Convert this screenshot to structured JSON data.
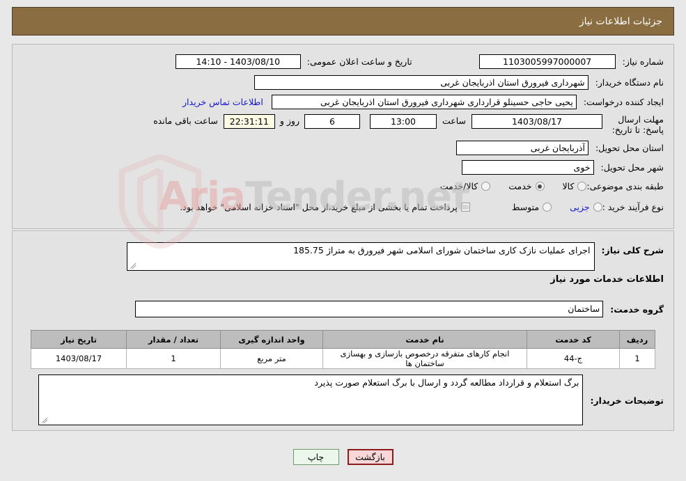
{
  "header": {
    "title": "جزئیات اطلاعات نیاز"
  },
  "form": {
    "need_number_label": "شماره نیاز:",
    "need_number_value": "1103005997000007",
    "announce_label": "تاریخ و ساعت اعلان عمومی:",
    "announce_value": "1403/08/10 - 14:10",
    "buyer_org_label": "نام دستگاه خریدار:",
    "buyer_org_value": "شهرداری فیرورق استان اذربایجان غربی",
    "requester_label": "ایجاد کننده درخواست:",
    "requester_value": "یحیی حاجی حسینلو قرارداری شهرداری فیرورق استان اذربایجان غربی",
    "contact_link": "اطلاعات تماس خریدار",
    "deadline_label": "مهلت ارسال پاسخ: تا تاریخ:",
    "deadline_date": "1403/08/17",
    "time_label": "ساعت",
    "deadline_time": "13:00",
    "days_value": "6",
    "days_label": "روز و",
    "countdown_value": "22:31:11",
    "remaining_label": "ساعت باقی مانده",
    "province_label": "استان محل تحویل:",
    "province_value": "آذربایجان غربی",
    "city_label": "شهر محل تحویل:",
    "city_value": "خوی",
    "category_label": "طبقه بندی موضوعی:",
    "category_options": [
      {
        "label": "کالا",
        "selected": false
      },
      {
        "label": "خدمت",
        "selected": true
      },
      {
        "label": "کالا/خدمت",
        "selected": false
      }
    ],
    "purchase_type_label": "نوع فرآیند خرید :",
    "purchase_options": [
      {
        "label": "جزیی",
        "selected": false
      },
      {
        "label": "متوسط",
        "selected": false
      }
    ],
    "treasury_checkbox_label": "پرداخت تمام یا بخشی از مبلغ خرید،از محل \"اسناد خزانه اسلامی\" خواهد بود.",
    "treasury_checked": false
  },
  "description": {
    "label": "شرح کلی نیاز:",
    "value": "اجرای عملیات نازک کاری ساختمان شورای اسلامی شهر فیرورق به متراژ 185.75"
  },
  "services": {
    "section_title": "اطلاعات خدمات مورد نیاز",
    "group_label": "گروه خدمت:",
    "group_value": "ساختمان",
    "columns": [
      "ردیف",
      "کد خدمت",
      "نام خدمت",
      "واحد اندازه گیری",
      "تعداد / مقدار",
      "تاریخ نیاز"
    ],
    "rows": [
      {
        "index": "1",
        "code": "ج-44",
        "name": "انجام کارهای متفرقه درخصوص بازسازی و بهسازی ساختمان ها",
        "unit": "متر مربع",
        "quantity": "1",
        "need_date": "1403/08/17"
      }
    ]
  },
  "buyer_notes": {
    "label": "توضیحات خریدار:",
    "value": "برگ استعلام و قرارداد مطالعه گردد و ارسال با برگ استعلام صورت پذیرد"
  },
  "footer": {
    "print_label": "چاپ",
    "back_label": "بازگشت"
  },
  "watermark": {
    "text_left": "Aria",
    "text_right": "Tender.net"
  },
  "colors": {
    "header_bar": "#8b6d42",
    "link": "#1414cc",
    "back_button_bg": "#f7d7d7",
    "print_button_bg": "#eaf7ea",
    "countdown_bg": "#fbfbe6"
  }
}
